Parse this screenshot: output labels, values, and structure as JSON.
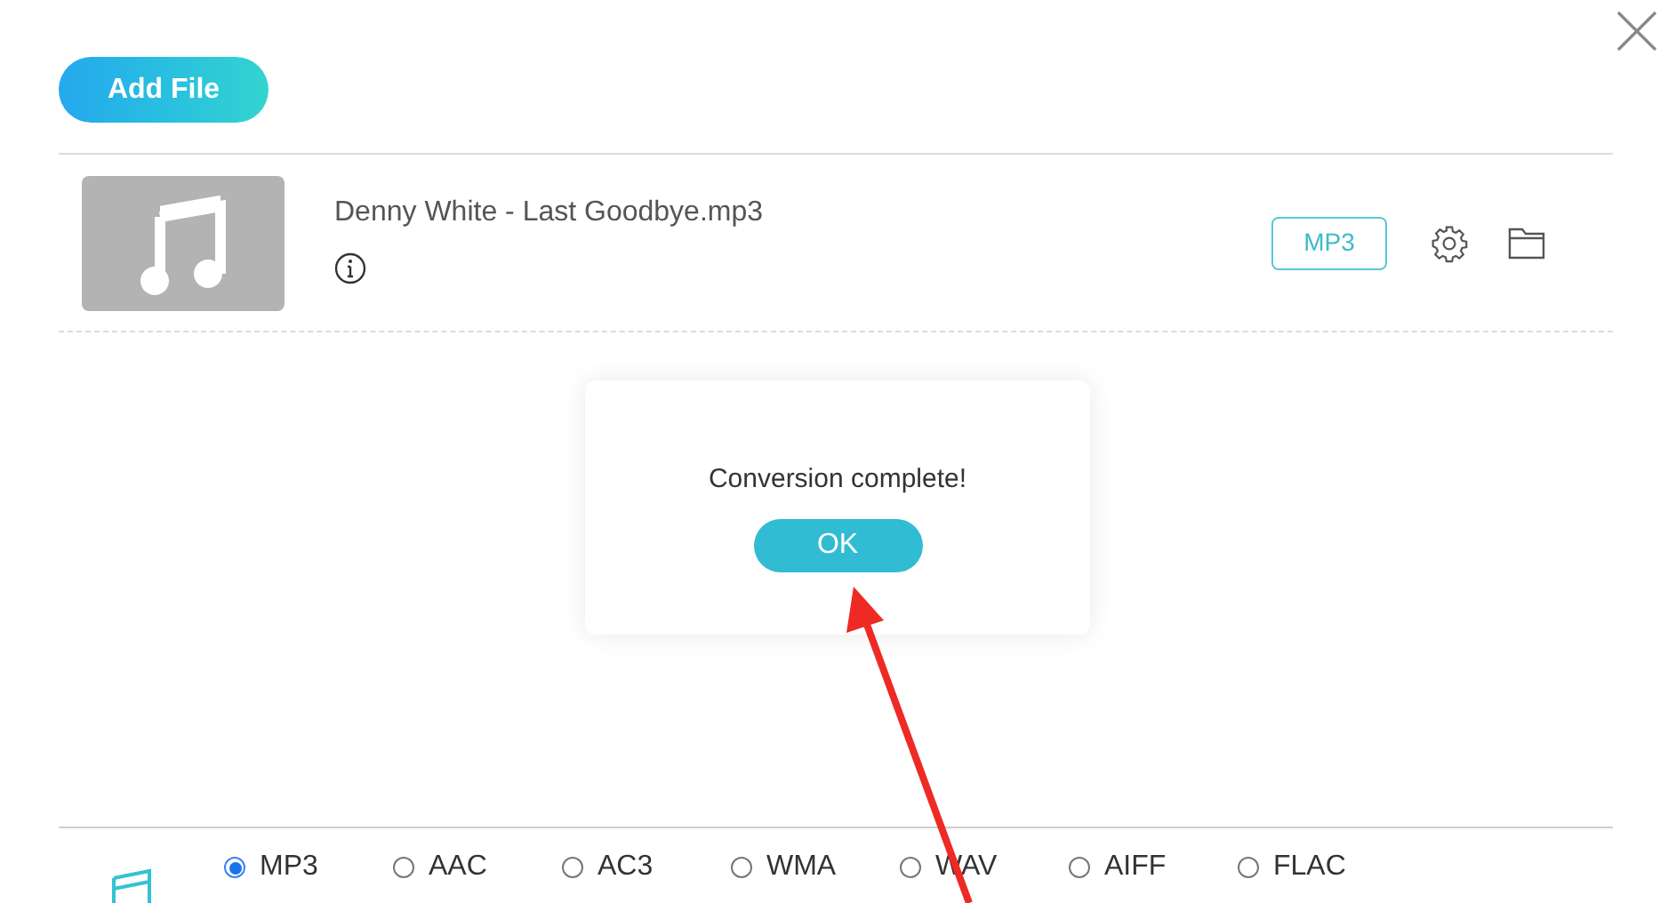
{
  "toolbar": {
    "add_button": "Add File"
  },
  "file": {
    "name": "Denny White - Last Goodbye.mp3",
    "format": "MP3"
  },
  "dialog": {
    "message": "Conversion complete!",
    "button": "OK"
  },
  "formats": [
    {
      "label": "MP3",
      "selected": true
    },
    {
      "label": "AAC",
      "selected": false
    },
    {
      "label": "AC3",
      "selected": false
    },
    {
      "label": "WMA",
      "selected": false
    },
    {
      "label": "WAV",
      "selected": false
    },
    {
      "label": "AIFF",
      "selected": false
    },
    {
      "label": "FLAC",
      "selected": false
    }
  ]
}
